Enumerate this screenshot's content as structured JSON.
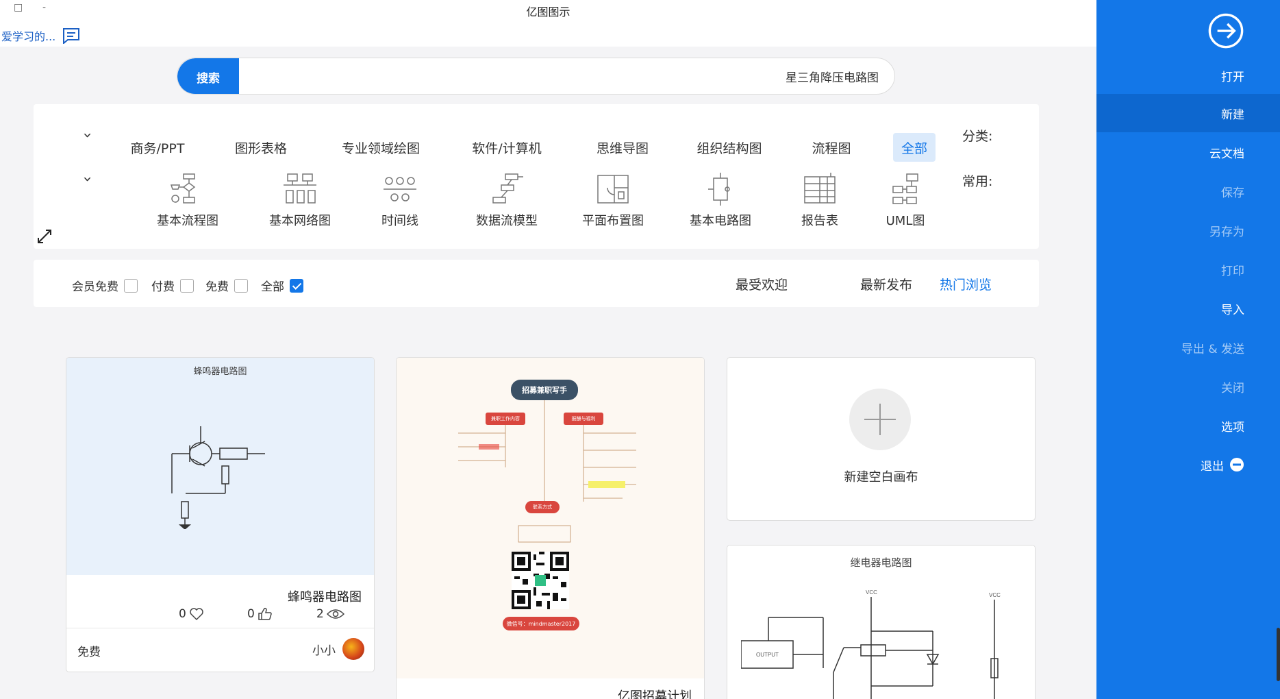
{
  "window": {
    "title": "亿图图示",
    "restore_glyph": "□",
    "minimize_glyph": "-"
  },
  "feedback": {
    "label": "爱学习的..."
  },
  "search": {
    "button_label": "搜索",
    "value": "星三角降压电路图"
  },
  "categories": {
    "label": "分类:",
    "items": [
      "全部",
      "流程图",
      "组织结构图",
      "思维导图",
      "软件/计算机",
      "专业领域绘图",
      "图形表格",
      "商务/PPT"
    ],
    "active": "全部"
  },
  "common": {
    "label": "常用:",
    "items": [
      {
        "label": "UML图",
        "icon": "uml-icon"
      },
      {
        "label": "报告表",
        "icon": "report-table-icon"
      },
      {
        "label": "基本电路图",
        "icon": "circuit-icon"
      },
      {
        "label": "平面布置图",
        "icon": "floor-plan-icon"
      },
      {
        "label": "数据流模型",
        "icon": "data-flow-icon"
      },
      {
        "label": "时间线",
        "icon": "timeline-icon"
      },
      {
        "label": "基本网络图",
        "icon": "network-icon"
      },
      {
        "label": "基本流程图",
        "icon": "flowchart-icon"
      }
    ]
  },
  "sort": {
    "items": [
      "热门浏览",
      "最新发布",
      "最受欢迎"
    ],
    "active": "热门浏览"
  },
  "filters": [
    {
      "label": "全部",
      "checked": true
    },
    {
      "label": "免费",
      "checked": false
    },
    {
      "label": "付费",
      "checked": false
    },
    {
      "label": "会员免费",
      "checked": false
    }
  ],
  "cards": {
    "new_blank": {
      "label": "新建空白画布"
    },
    "buzzer": {
      "thumb_title": "蜂鸣器电路图",
      "title": "蜂鸣器电路图",
      "views": "2",
      "likes": "0",
      "favorites": "0",
      "author": "小小",
      "price": "免费"
    },
    "mindmap": {
      "root": "招募兼职写手",
      "branch_left": "兼职工作内容",
      "branch_right": "报酬与福利",
      "branch_bottom": "联系方式",
      "wechat": "微信号：mindmaster2017",
      "title": "亿图招募计划"
    },
    "relay": {
      "thumb_title": "继电器电路图"
    }
  },
  "sidebar": {
    "open": "打开",
    "new": "新建",
    "cloud": "云文档",
    "save": "保存",
    "save_as": "另存为",
    "print": "打印",
    "import": "导入",
    "export_send": "导出 & 发送",
    "close": "关闭",
    "options": "选项",
    "exit": "退出"
  },
  "colors": {
    "accent": "#1377e8",
    "sidebar_active": "#0d67cf"
  }
}
